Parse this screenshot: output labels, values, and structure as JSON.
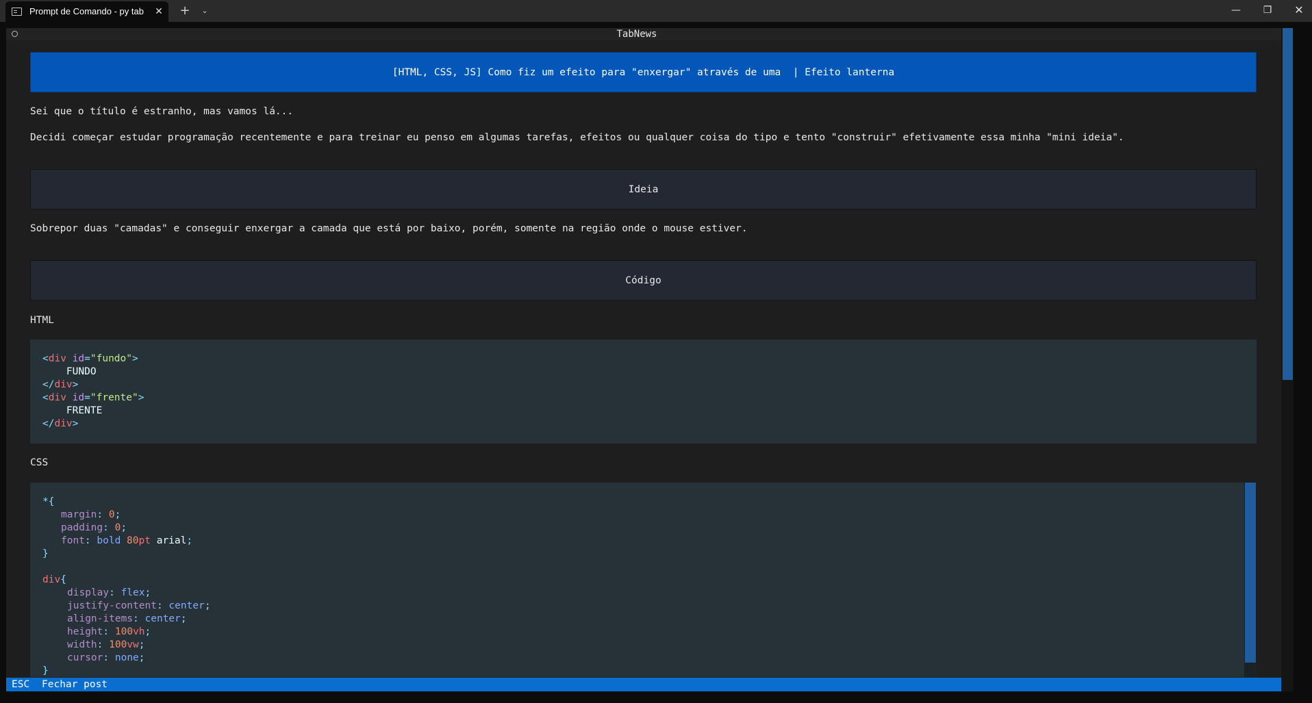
{
  "window": {
    "tab_title": "Prompt de Comando - py  tab",
    "tab_close": "✕",
    "new_tab": "+",
    "tab_dropdown": "⌄",
    "minimize": "—",
    "maximize": "❐",
    "close": "✕"
  },
  "app": {
    "header_title": "TabNews",
    "status_key": "ESC",
    "status_action": "Fechar post"
  },
  "post": {
    "title": "[HTML, CSS, JS] Como fiz um efeito para \"enxergar\" através de uma  | Efeito lanterna",
    "intro_1": "Sei que o título é estranho, mas vamos lá...",
    "intro_2": "Decidi começar estudar programação recentemente e para treinar eu penso em algumas tarefas, efeitos ou qualquer coisa do tipo e tento \"construir\" efetivamente essa minha \"mini ideia\".",
    "section_ideia": "Ideia",
    "ideia_text": "Sobrepor duas \"camadas\" e conseguir enxergar a camada que está por baixo, porém, somente na região onde o mouse estiver.",
    "section_codigo": "Código",
    "label_html": "HTML",
    "label_css": "CSS"
  },
  "html_code": {
    "l1_open": "<",
    "l1_tag": "div",
    "l1_attr": " id",
    "l1_eq": "=",
    "l1_str": "\"fundo\"",
    "l1_close": ">",
    "l2_text": "    FUNDO",
    "l3_open": "</",
    "l3_tag": "div",
    "l3_close": ">",
    "l4_open": "<",
    "l4_tag": "div",
    "l4_attr": " id",
    "l4_eq": "=",
    "l4_str": "\"frente\"",
    "l4_close": ">",
    "l5_text": "    FRENTE",
    "l6_open": "</",
    "l6_tag": "div",
    "l6_close": ">"
  },
  "css_code": {
    "r1_sel": "*{",
    "r1_p1": "margin",
    "r1_p1c": ": ",
    "r1_v1": "0",
    "r1_p1e": ";",
    "r1_p2": "padding",
    "r1_p2c": ": ",
    "r1_v2": "0",
    "r1_p2e": ";",
    "r1_p3": "font",
    "r1_p3c": ": ",
    "r1_v3a": "bold ",
    "r1_v3b": "80",
    "r1_v3u": "pt",
    "r1_v3c": " arial",
    "r1_p3e": ";",
    "r1_end": "}",
    "r2_sel": "div",
    "r2_brace": "{",
    "r2_p1": "display",
    "r2_p1c": ": ",
    "r2_v1": "flex",
    "r2_p1e": ";",
    "r2_p2": "justify-content",
    "r2_p2c": ": ",
    "r2_v2": "center",
    "r2_p2e": ";",
    "r2_p3": "align-items",
    "r2_p3c": ": ",
    "r2_v3": "center",
    "r2_p3e": ";",
    "r2_p4": "height",
    "r2_p4c": ": ",
    "r2_v4": "100",
    "r2_v4u": "vh",
    "r2_p4e": ";",
    "r2_p5": "width",
    "r2_p5c": ": ",
    "r2_v5": "100",
    "r2_v5u": "vw",
    "r2_p5e": ";",
    "r2_p6": "cursor",
    "r2_p6c": ": ",
    "r2_v6": "none",
    "r2_p6e": ";",
    "r2_end": "}"
  },
  "colors": {
    "title_bar": "#0257b8",
    "status_bar": "#0a6ed1",
    "code_bg": "#263238",
    "section_bg": "#242832"
  }
}
